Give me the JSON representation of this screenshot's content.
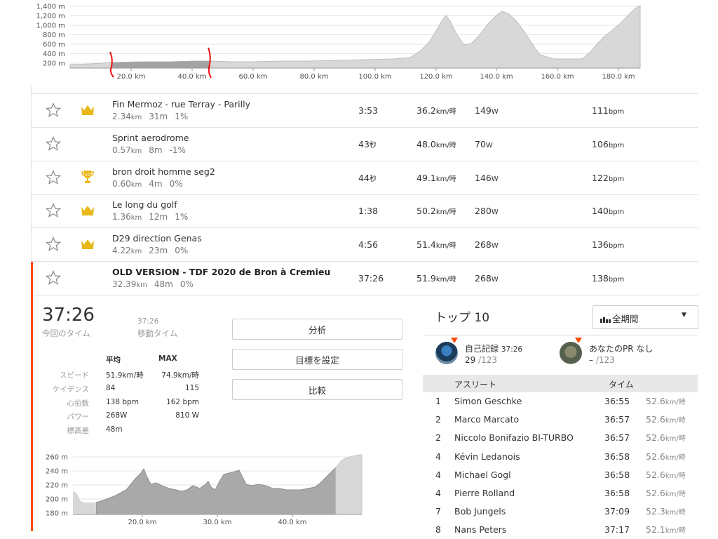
{
  "top_elevation": {
    "y_ticks": [
      "1,400 m",
      "1,200 m",
      "1,000 m",
      "800 m",
      "600 m",
      "400 m",
      "200 m"
    ],
    "x_ticks": [
      "20.0 km",
      "40.0 km",
      "60.0 km",
      "80.0 km",
      "100.0 km",
      "120.0 km",
      "140.0 km",
      "160.0 km",
      "180.0 km"
    ]
  },
  "segments": [
    {
      "name": "Fin Mermoz - rue Terray - Parilly",
      "dist": "2.34",
      "dist_unit": "km",
      "elev": "31m",
      "grade": "1%",
      "time": "3:53",
      "time_unit": "",
      "speed": "36.2",
      "speed_unit": "km/時",
      "power": "149",
      "power_unit": "W",
      "hr": "111",
      "hr_unit": "bpm",
      "badge": "crown",
      "selected": false
    },
    {
      "name": "Sprint aerodrome",
      "dist": "0.57",
      "dist_unit": "km",
      "elev": "8m",
      "grade": "-1%",
      "time": "43",
      "time_unit": "秒",
      "speed": "48.0",
      "speed_unit": "km/時",
      "power": "70",
      "power_unit": "W",
      "hr": "106",
      "hr_unit": "bpm",
      "badge": "",
      "selected": false
    },
    {
      "name": "bron droit homme seg2",
      "dist": "0.60",
      "dist_unit": "km",
      "elev": "4m",
      "grade": "0%",
      "time": "44",
      "time_unit": "秒",
      "speed": "49.1",
      "speed_unit": "km/時",
      "power": "146",
      "power_unit": "W",
      "hr": "122",
      "hr_unit": "bpm",
      "badge": "trophy",
      "selected": false
    },
    {
      "name": "Le long du golf",
      "dist": "1.36",
      "dist_unit": "km",
      "elev": "12m",
      "grade": "1%",
      "time": "1:38",
      "time_unit": "",
      "speed": "50.2",
      "speed_unit": "km/時",
      "power": "280",
      "power_unit": "W",
      "hr": "140",
      "hr_unit": "bpm",
      "badge": "crown",
      "selected": false
    },
    {
      "name": "D29 direction Genas",
      "dist": "4.22",
      "dist_unit": "km",
      "elev": "23m",
      "grade": "0%",
      "time": "4:56",
      "time_unit": "",
      "speed": "51.4",
      "speed_unit": "km/時",
      "power": "268",
      "power_unit": "W",
      "hr": "136",
      "hr_unit": "bpm",
      "badge": "crown",
      "selected": false
    },
    {
      "name": "OLD VERSION - TDF 2020 de Bron à Cremieu",
      "dist": "32.39",
      "dist_unit": "km",
      "elev": "48m",
      "grade": "0%",
      "time": "37:26",
      "time_unit": "",
      "speed": "51.9",
      "speed_unit": "km/時",
      "power": "268",
      "power_unit": "W",
      "hr": "138",
      "hr_unit": "bpm",
      "badge": "",
      "selected": true
    }
  ],
  "detail": {
    "elapsed_time": "37:26",
    "elapsed_label": "今回のタイム",
    "moving_time": "37:26",
    "moving_label": "移動タイム",
    "buttons": {
      "analyze": "分析",
      "set_goal": "目標を設定",
      "compare": "比較"
    },
    "stats_header": {
      "avg": "平均",
      "max": "MAX"
    },
    "stats": [
      {
        "label": "スピード",
        "avg": "51.9km/時",
        "max": "74.9km/時"
      },
      {
        "label": "ケイデンス",
        "avg": "84",
        "max": "115"
      },
      {
        "label": "心拍数",
        "avg": "138 bpm",
        "max": "162 bpm"
      },
      {
        "label": "パワー",
        "avg": "268W",
        "max": "810 W"
      },
      {
        "label": "標高差",
        "avg": "48m",
        "max": ""
      }
    ],
    "elevation": {
      "y_ticks": [
        "260 m",
        "240 m",
        "220 m",
        "200 m",
        "180 m"
      ],
      "x_ticks": [
        "20.0 km",
        "30.0 km",
        "40.0 km"
      ]
    }
  },
  "leaderboard": {
    "title": "トップ 10",
    "period": "全期間",
    "my_record": {
      "label": "自己記録",
      "time": "37:26",
      "rank": "29",
      "total": "/123"
    },
    "your_pr": {
      "label": "あなたのPR",
      "value": "なし",
      "rank": "–",
      "total": "/123"
    },
    "columns": {
      "athlete": "アスリート",
      "time": "タイム"
    },
    "rows": [
      {
        "rank": "1",
        "name": "Simon Geschke",
        "time": "36:55",
        "speed": "52.6",
        "unit": "km/時"
      },
      {
        "rank": "2",
        "name": "Marco Marcato",
        "time": "36:57",
        "speed": "52.6",
        "unit": "km/時"
      },
      {
        "rank": "2",
        "name": "Niccolo Bonifazio BI-TURBO",
        "time": "36:57",
        "speed": "52.6",
        "unit": "km/時"
      },
      {
        "rank": "4",
        "name": "Kévin Ledanois",
        "time": "36:58",
        "speed": "52.6",
        "unit": "km/時"
      },
      {
        "rank": "4",
        "name": "Michael Gogl",
        "time": "36:58",
        "speed": "52.6",
        "unit": "km/時"
      },
      {
        "rank": "4",
        "name": "Pierre Rolland",
        "time": "36:58",
        "speed": "52.6",
        "unit": "km/時"
      },
      {
        "rank": "7",
        "name": "Bob Jungels",
        "time": "37:09",
        "speed": "52.3",
        "unit": "km/時"
      },
      {
        "rank": "8",
        "name": "Nans Peters",
        "time": "37:17",
        "speed": "52.1",
        "unit": "km/時"
      }
    ]
  },
  "colors": {
    "accent": "#fc4c02",
    "crown": "#e8b819",
    "elev_fill": "#d6d6d6",
    "elev_dark": "#9a9a9a",
    "annot": "#e11"
  }
}
